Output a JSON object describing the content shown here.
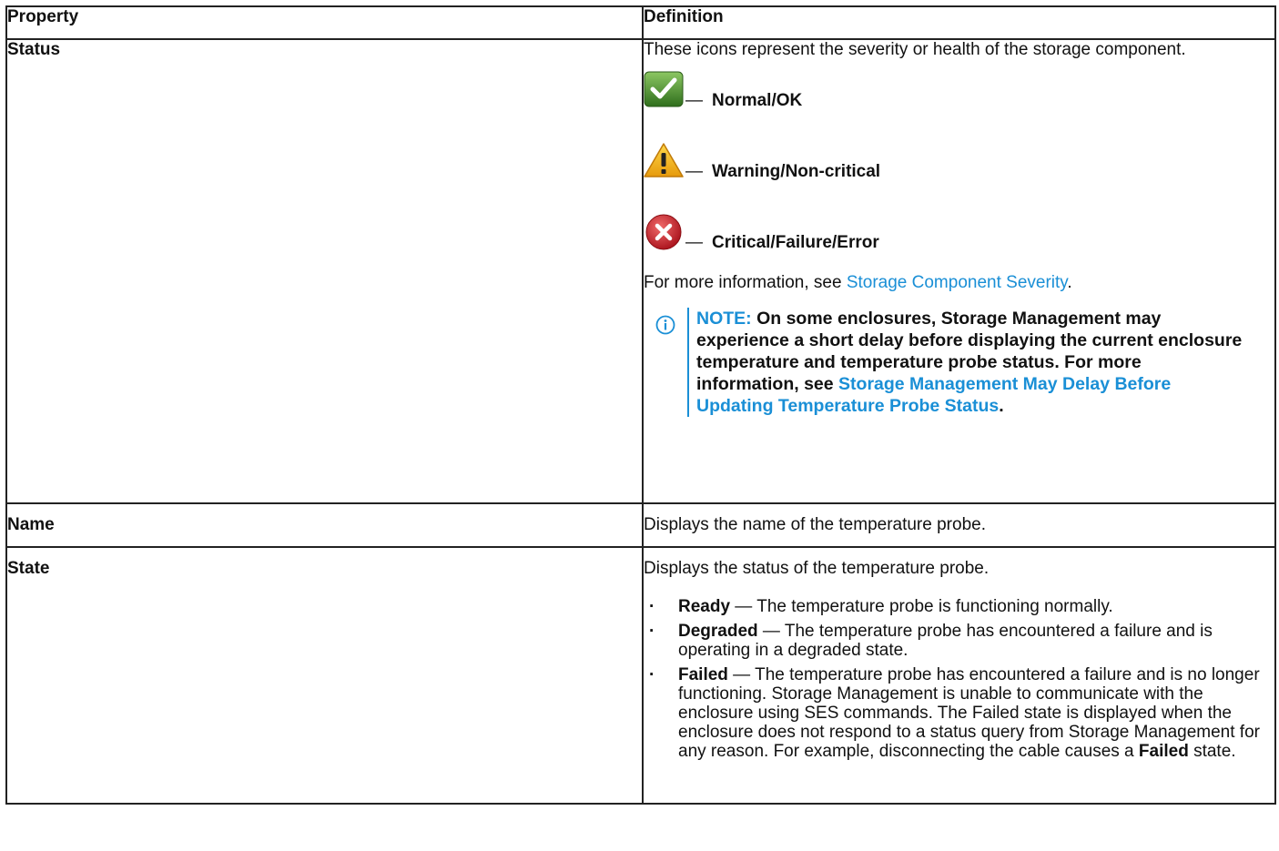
{
  "headers": {
    "property": "Property",
    "definition": "Definition"
  },
  "rows": {
    "status": {
      "property": "Status",
      "intro": "These icons represent the severity or health of the storage component.",
      "icons": [
        {
          "icon": "check-icon",
          "dash": "—",
          "label": "Normal/OK",
          "color": "#4a8a2a"
        },
        {
          "icon": "warning-icon",
          "dash": "—",
          "label": "Warning/Non-critical",
          "color": "#f2b21c"
        },
        {
          "icon": "error-icon",
          "dash": "—",
          "label": "Critical/Failure/Error",
          "color": "#c8202a"
        }
      ],
      "more_info_prefix": "For more information, see ",
      "more_info_link": "Storage Component Severity",
      "more_info_suffix": ".",
      "note_label": "NOTE:",
      "note_text": " On some enclosures, Storage Management may experience a short delay before displaying the current enclosure temperature and temperature probe status. For more information, see ",
      "note_link": "Storage Management May Delay Before Updating Temperature Probe Status",
      "note_suffix": "."
    },
    "name": {
      "property": "Name",
      "definition": "Displays the name of the temperature probe."
    },
    "state": {
      "property": "State",
      "intro": "Displays the status of the temperature probe.",
      "items": [
        {
          "term": "Ready",
          "text": " — The temperature probe is functioning normally."
        },
        {
          "term": "Degraded",
          "text": " — The temperature probe has encountered a failure and is operating in a degraded state."
        },
        {
          "term": "Failed",
          "text": " — The temperature probe has encountered a failure and is no longer functioning. Storage Management is unable to communicate with the enclosure using SES commands. The Failed state is displayed when the enclosure does not respond to a status query from Storage Management for any reason. For example, disconnecting the cable causes a ",
          "term2": "Failed",
          "text2": " state."
        }
      ]
    }
  }
}
